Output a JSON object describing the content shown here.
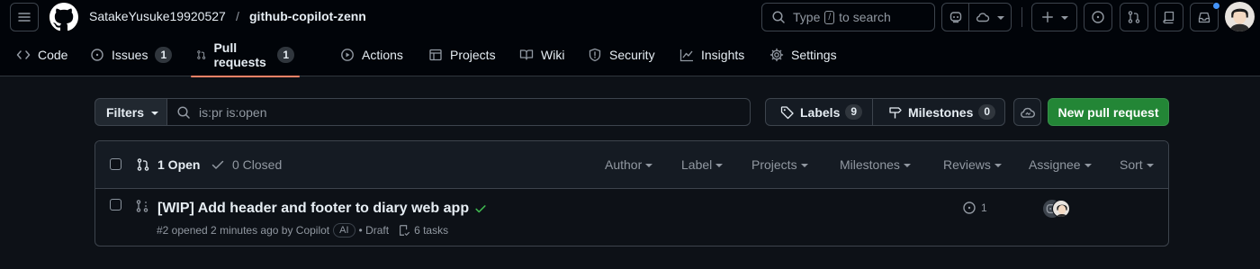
{
  "header": {
    "owner": "SatakeYusuke19920527",
    "separator": "/",
    "repo": "github-copilot-zenn",
    "search_prefix": "Type",
    "search_key": "/",
    "search_suffix": "to search"
  },
  "tabs": [
    {
      "label": "Code",
      "icon": "code-icon"
    },
    {
      "label": "Issues",
      "icon": "issue-opened-icon",
      "count": "1"
    },
    {
      "label": "Pull requests",
      "icon": "git-pull-request-icon",
      "count": "1",
      "active": true
    },
    {
      "label": "Actions",
      "icon": "play-icon"
    },
    {
      "label": "Projects",
      "icon": "table-icon"
    },
    {
      "label": "Wiki",
      "icon": "book-icon"
    },
    {
      "label": "Security",
      "icon": "shield-icon"
    },
    {
      "label": "Insights",
      "icon": "graph-icon"
    },
    {
      "label": "Settings",
      "icon": "gear-icon"
    }
  ],
  "toolbar": {
    "filters_label": "Filters",
    "search_value": "is:pr is:open",
    "labels_label": "Labels",
    "labels_count": "9",
    "milestones_label": "Milestones",
    "milestones_count": "0",
    "new_pr_label": "New pull request"
  },
  "list_header": {
    "open_label": "1 Open",
    "closed_label": "0 Closed",
    "filters": [
      "Author",
      "Label",
      "Projects",
      "Milestones",
      "Reviews",
      "Assignee",
      "Sort"
    ]
  },
  "pull_requests": [
    {
      "title": "[WIP] Add header and footer to diary web app",
      "status_icon": "check-icon",
      "meta_prefix": "#2 opened 2 minutes ago by Copilot",
      "author_badge": "AI",
      "draft_label": "• Draft",
      "tasks_label": "6 tasks",
      "linked_issues": "1"
    }
  ],
  "colors": {
    "background": "#0d1117",
    "header_bg": "#010409",
    "accent_underline": "#f78166",
    "primary_button": "#238636",
    "success_check": "#3fb950",
    "notification_dot": "#4493f8"
  }
}
